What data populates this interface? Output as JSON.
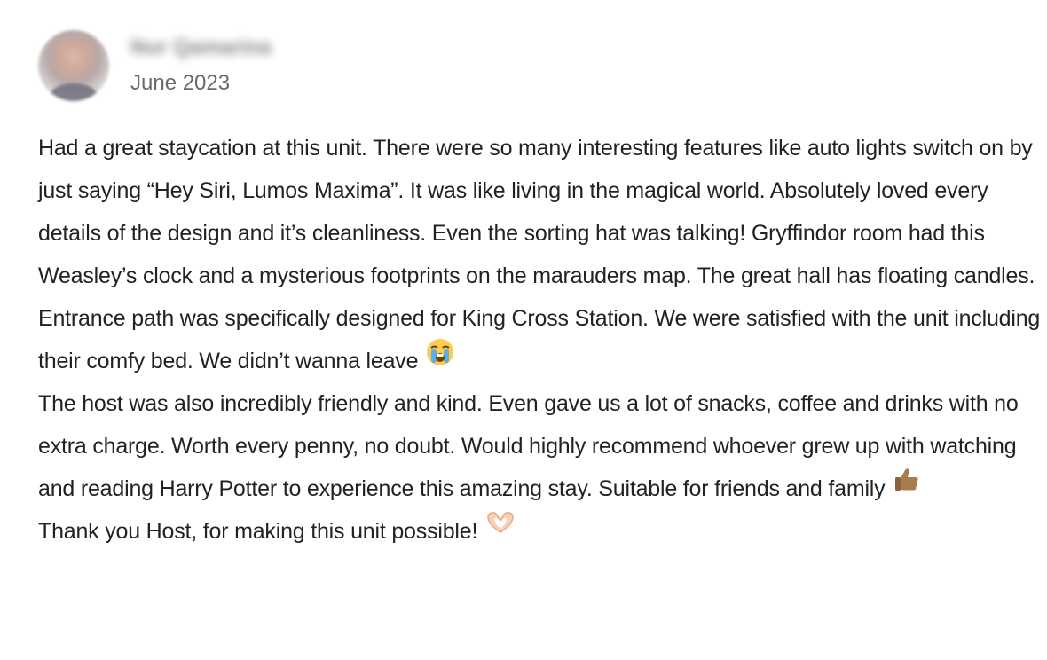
{
  "review": {
    "author_name": "Nur Qamarina",
    "date": "June 2023",
    "paragraphs": [
      "Had a great staycation at this unit. There were so many interesting features like auto lights switch on by just saying “Hey Siri, Lumos Maxima”. It was like living in the magical world. Absolutely loved every details of the design and it’s cleanliness. Even the sorting hat was talking! Gryffindor room had this Weasley’s clock and a mysterious footprints on the marauders map. The great hall has floating candles. Entrance path was specifically designed for King Cross Station. We were satisfied with the unit including their comfy bed. We didn’t wanna leave",
      "The host was also incredibly friendly and kind. Even gave us a lot of snacks, coffee and drinks with no extra charge. Worth every penny, no doubt. Would highly recommend whoever grew up with watching and reading Harry Potter to experience this amazing stay. Suitable for friends and family",
      "Thank you Host, for making this unit possible!"
    ],
    "emojis": [
      "loudly-crying-face-icon",
      "thumbs-up-icon",
      "heart-hands-icon"
    ]
  }
}
